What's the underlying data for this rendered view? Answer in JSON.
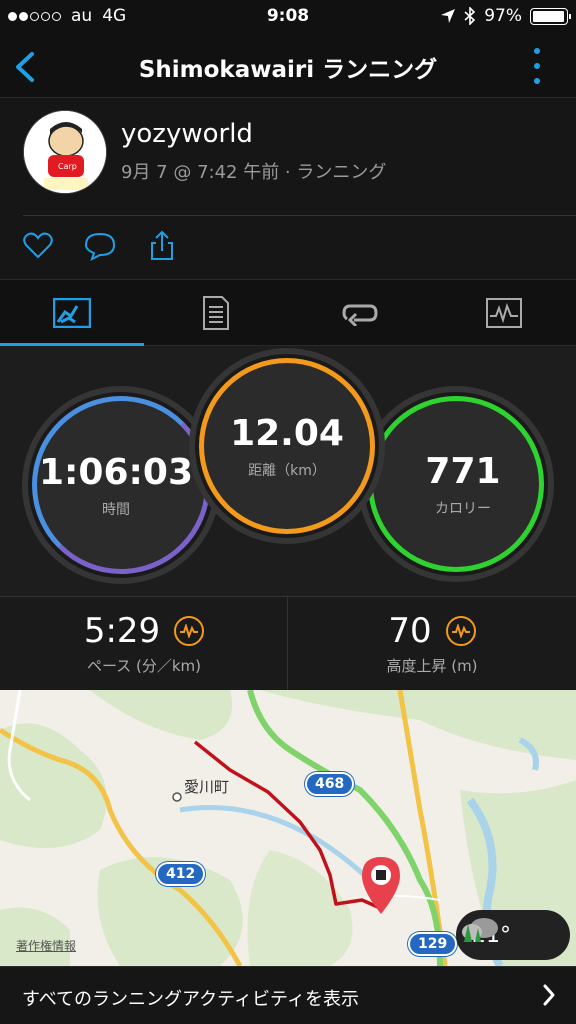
{
  "status_bar": {
    "carrier": "au",
    "network": "4G",
    "time": "9:08",
    "battery": "97%",
    "battery_level": 0.97,
    "signal_bars": 2
  },
  "nav": {
    "title": "Shimokawairi ランニング",
    "icons": [
      "chevron-left-icon",
      "more-vertical-icon"
    ]
  },
  "profile": {
    "username": "yozyworld",
    "meta": "9月 7 @ 7:42 午前 · ランニング",
    "actions": [
      "like-icon",
      "comment-icon",
      "share-icon"
    ]
  },
  "tabs": [
    "stats-tab-icon",
    "details-tab-icon",
    "laps-tab-icon",
    "chart-tab-icon"
  ],
  "stats": {
    "time": {
      "value": "1:06:03",
      "label": "時間"
    },
    "distance": {
      "value": "12.04",
      "label": "距離（km）"
    },
    "calories": {
      "value": "771",
      "label": "カロリー"
    }
  },
  "sub_stats": {
    "pace": {
      "value": "5:29",
      "label": "ペース (分／km)"
    },
    "elevation": {
      "value": "70",
      "label": "高度上昇 (m)"
    }
  },
  "map": {
    "town_label": "愛川町",
    "route_468": "468",
    "route_412": "412",
    "route_129": "129",
    "copyright": "著作権情報",
    "temperature": "21°"
  },
  "footer": {
    "text": "すべてのランニングアクティビティを表示"
  },
  "colors": {
    "accent": "#1fa0e6",
    "time_ring": "#4a8fe0",
    "distance_ring": "#f39a1c",
    "calorie_ring": "#2fd32f",
    "route": "#c0121b"
  }
}
